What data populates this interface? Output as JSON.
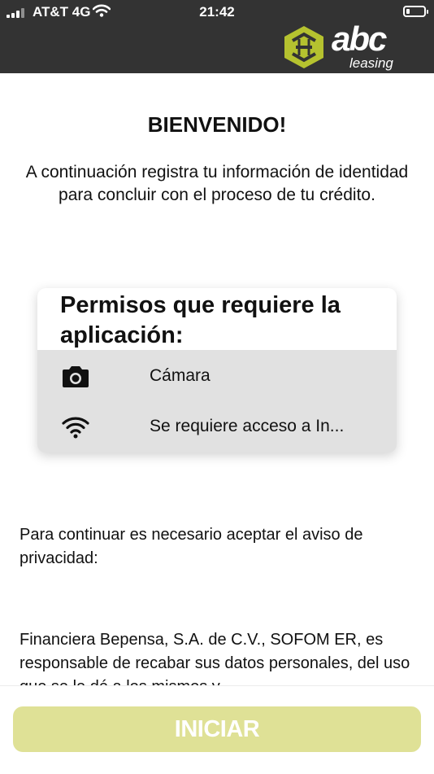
{
  "status_bar": {
    "carrier": "AT&T 4G",
    "time": "21:42"
  },
  "brand": {
    "name": "abc",
    "sub": "leasing",
    "logo_color": "#b5c22f"
  },
  "main": {
    "title": "BIENVENIDO!",
    "intro": "A continuación registra tu información de identidad para concluir con el proceso de tu crédito."
  },
  "permissions": {
    "title": "Permisos que requiere la aplicación:",
    "items": [
      {
        "icon": "camera-icon",
        "label": "Cámara"
      },
      {
        "icon": "wifi-icon",
        "label": "Se requiere acceso a In..."
      }
    ]
  },
  "privacy": {
    "prompt": "Para continuar es necesario aceptar el aviso de privacidad:",
    "text": "Financiera Bepensa, S.A. de C.V., SOFOM ER, es responsable de recabar sus datos personales, del uso que se le dé a los mismos y"
  },
  "actions": {
    "start_label": "INICIAR",
    "start_color": "#dfe196"
  }
}
